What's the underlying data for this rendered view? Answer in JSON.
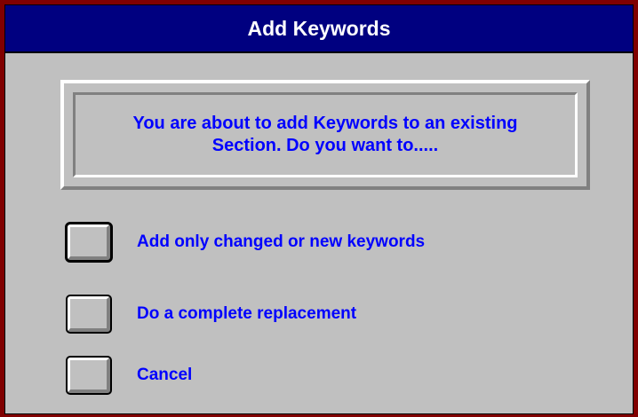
{
  "window": {
    "title": "Add Keywords"
  },
  "message": {
    "text": "You are about to add Keywords to an existing\nSection.  Do you want to....."
  },
  "options": [
    {
      "label": "Add only changed or new keywords"
    },
    {
      "label": "Do a complete replacement"
    },
    {
      "label": "Cancel"
    }
  ],
  "colors": {
    "title_bar": "#000080",
    "frame": "#800000",
    "face": "#c0c0c0",
    "text": "#0000ff"
  }
}
